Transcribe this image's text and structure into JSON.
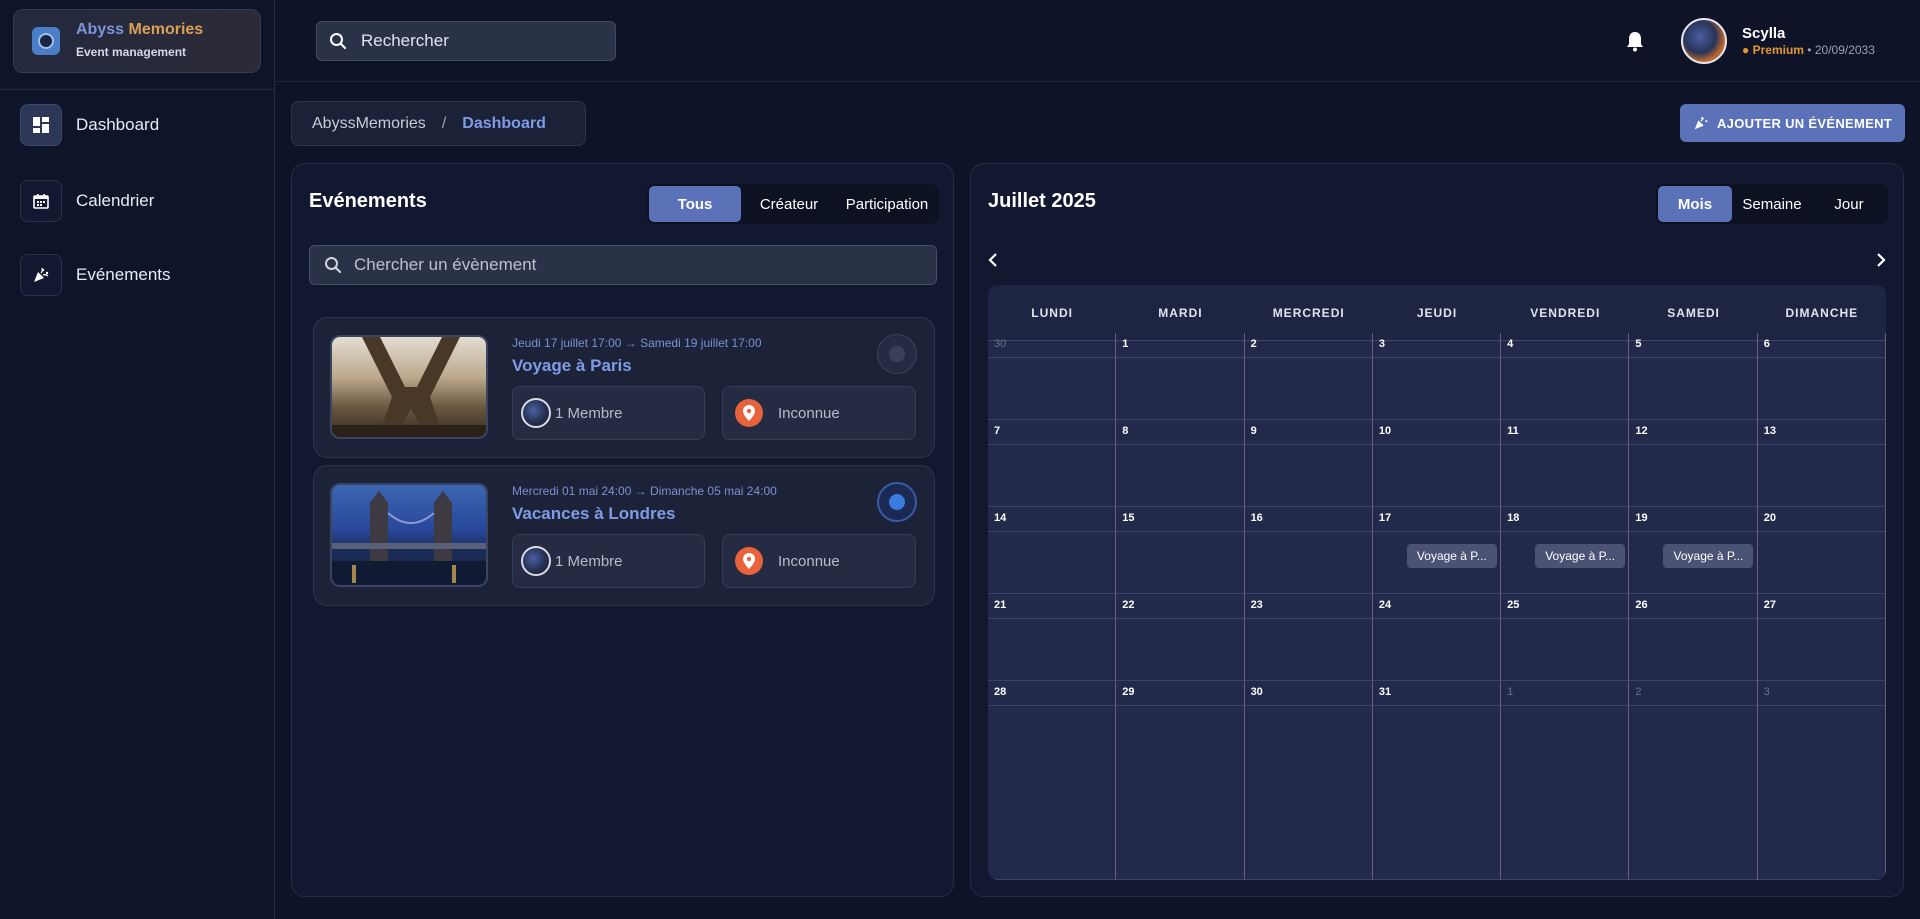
{
  "brand": {
    "title_a": "Abyss",
    "title_b": "Memories",
    "subtitle": "Event management"
  },
  "sidebar": {
    "items": [
      {
        "label": "Dashboard",
        "icon": "dashboard-icon",
        "active": true
      },
      {
        "label": "Calendrier",
        "icon": "calendar-icon",
        "active": false
      },
      {
        "label": "Evénements",
        "icon": "party-popper-icon",
        "active": false
      }
    ]
  },
  "header": {
    "search_text": "Rechercher",
    "user": {
      "name": "Scylla",
      "status": "Premium",
      "date": "20/09/2033"
    }
  },
  "breadcrumb": {
    "root": "AbyssMemories",
    "sep": "/",
    "current": "Dashboard"
  },
  "actions": {
    "add_event": "AJOUTER UN ÉVÉNEMENT"
  },
  "events": {
    "title": "Evénements",
    "filters": [
      "Tous",
      "Créateur",
      "Participation"
    ],
    "active_filter": "Tous",
    "search_placeholder": "Chercher un évènement",
    "items": [
      {
        "date": "Jeudi 17 juillet 17:00 → Samedi 19 juillet 17:00",
        "title": "Voyage à Paris",
        "members": "1 Membre",
        "location": "Inconnue",
        "selected": false
      },
      {
        "date": "Mercredi 01 mai 24:00 → Dimanche 05 mai 24:00",
        "title": "Vacances à Londres",
        "members": "1 Membre",
        "location": "Inconnue",
        "selected": true
      }
    ]
  },
  "calendar": {
    "title": "Juillet 2025",
    "views": [
      "Mois",
      "Semaine",
      "Jour"
    ],
    "active_view": "Mois",
    "prev": "‹",
    "next": "›",
    "weekdays": [
      "LUNDI",
      "MARDI",
      "MERCREDI",
      "JEUDI",
      "VENDREDI",
      "SAMEDI",
      "DIMANCHE"
    ],
    "weeks": [
      [
        "30",
        "1",
        "2",
        "3",
        "4",
        "5",
        "6"
      ],
      [
        "7",
        "8",
        "9",
        "10",
        "11",
        "12",
        "13"
      ],
      [
        "14",
        "15",
        "16",
        "17",
        "18",
        "19",
        "20"
      ],
      [
        "21",
        "22",
        "23",
        "24",
        "25",
        "26",
        "27"
      ],
      [
        "28",
        "29",
        "30",
        "31",
        "1",
        "2",
        "3"
      ]
    ],
    "outside_month": [
      [
        0,
        0
      ],
      [
        4,
        4
      ],
      [
        4,
        5
      ],
      [
        4,
        6
      ]
    ],
    "events": [
      {
        "week": 2,
        "day": 3,
        "label": "Voyage à P..."
      },
      {
        "week": 2,
        "day": 4,
        "label": "Voyage à P..."
      },
      {
        "week": 2,
        "day": 5,
        "label": "Voyage à P..."
      }
    ]
  },
  "colors": {
    "accent": "#5b72b9",
    "title_blue": "#7f9be6",
    "premium": "#e39a2d",
    "pin": "#e8633c"
  }
}
